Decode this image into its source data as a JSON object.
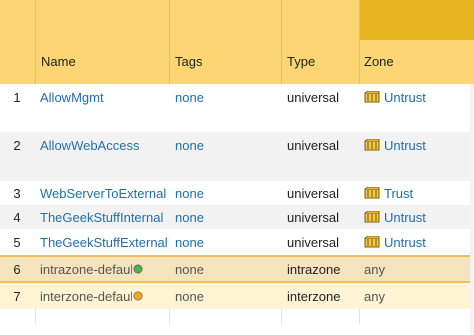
{
  "columns": {
    "index": "",
    "name": "Name",
    "tags": "Tags",
    "type": "Type",
    "zone": "Zone"
  },
  "rows": [
    {
      "index": "1",
      "name": "AllowMgmt",
      "tags": "none",
      "type": "universal",
      "zone": "Untrust",
      "zone_icon": "zone-icon"
    },
    {
      "index": "2",
      "name": "AllowWebAccess",
      "tags": "none",
      "type": "universal",
      "zone": "Untrust",
      "zone_icon": "zone-icon"
    },
    {
      "index": "3",
      "name": "WebServerToExternal",
      "tags": "none",
      "type": "universal",
      "zone": "Trust",
      "zone_icon": "zone-icon"
    },
    {
      "index": "4",
      "name": "TheGeekStuffInternal",
      "tags": "none",
      "type": "universal",
      "zone": "Untrust",
      "zone_icon": "zone-icon"
    },
    {
      "index": "5",
      "name": "TheGeekStuffExternal",
      "tags": "none",
      "type": "universal",
      "zone": "Untrust",
      "zone_icon": "zone-icon"
    },
    {
      "index": "6",
      "name": "intrazone-default",
      "tags": "none",
      "type": "intrazone",
      "zone": "any",
      "status_icon": "green-status-icon"
    },
    {
      "index": "7",
      "name": "interzone-default",
      "tags": "none",
      "type": "interzone",
      "zone": "any",
      "status_icon": "orange-status-icon"
    }
  ],
  "colors": {
    "header_bg": "#fbd672",
    "header_zone_band": "#e6b21e",
    "link": "#1f6fa8",
    "selected_row": "#f5e3bd",
    "highlight_row": "#fff4d4"
  }
}
